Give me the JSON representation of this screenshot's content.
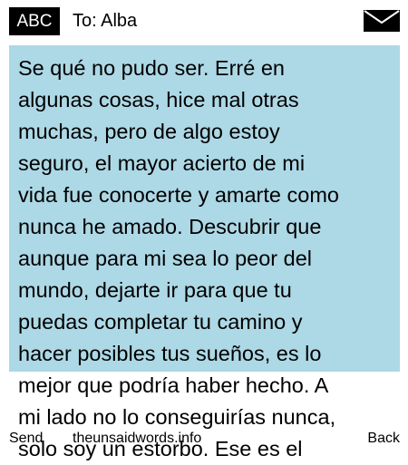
{
  "header": {
    "mode_badge": "ABC",
    "recipient_label": "To: Alba",
    "icon": "envelope-icon"
  },
  "message": {
    "background_color": "#add8e6",
    "lines": [
      "Se qué no pudo ser. Erré en",
      "algunas cosas, hice mal otras",
      "muchas, pero de algo estoy",
      "seguro, el mayor acierto de mi",
      "vida fue conocerte y amarte como",
      "nunca he amado. Descubrir que",
      "aunque para mi sea lo peor del",
      "mundo, dejarte ir para que tu",
      "puedas completar tu camino y",
      "hacer posibles tus sueños, es lo",
      "mejor que podría haber hecho. A",
      "mi lado no lo conseguirías nunca,",
      "solo soy un estorbo. Ese es el"
    ]
  },
  "footer": {
    "left_softkey": "Send",
    "center_text": "theunsaidwords.info",
    "right_softkey": "Back"
  }
}
